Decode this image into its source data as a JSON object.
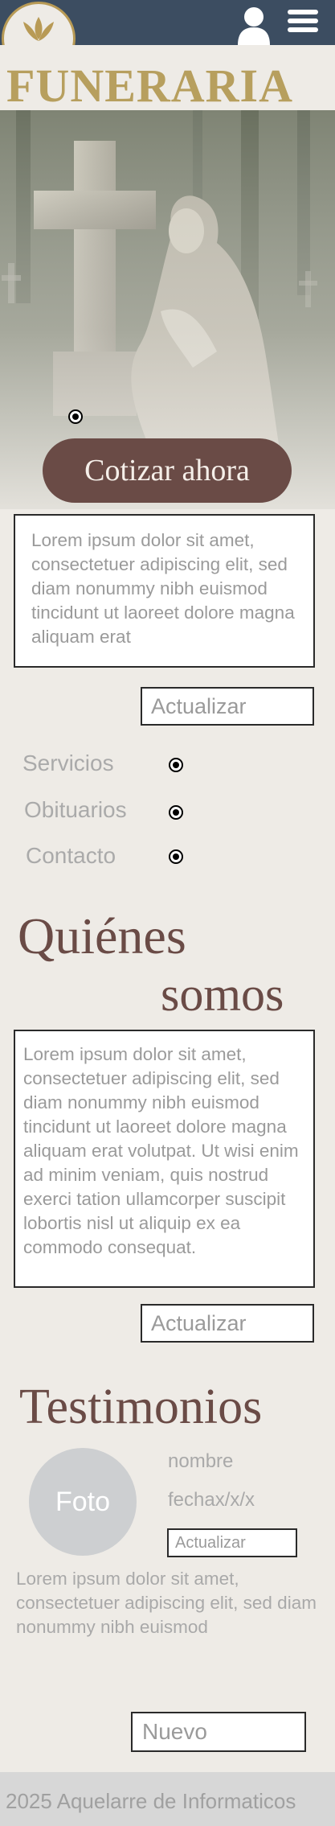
{
  "header": {
    "logo_icon": "lotus-logo-icon",
    "user_icon": "user-icon",
    "menu_icon": "hamburger-menu-icon",
    "brand": "FUNERARIA"
  },
  "hero": {
    "image": "cemetery-cross-and-mourning-statue",
    "cta_label": "Cotizar ahora"
  },
  "intro": {
    "text": "Lorem ipsum dolor sit amet, consectetuer adipiscing elit, sed diam nonummy nibh euismod tincidunt ut laoreet dolore magna aliquam erat",
    "update_label": "Actualizar"
  },
  "nav": {
    "items": [
      {
        "label": "Servicios"
      },
      {
        "label": "Obituarios"
      },
      {
        "label": "Contacto"
      }
    ]
  },
  "about": {
    "title_line1": "Quiénes",
    "title_line2": "somos",
    "text": "Lorem ipsum dolor sit amet, consectetuer adipiscing elit, sed diam nonummy nibh euismod tincidunt ut laoreet dolore magna aliquam erat volutpat. Ut wisi enim ad minim veniam, quis nostrud exerci tation ullamcorper suscipit lobortis nisl ut aliquip ex ea commodo consequat.",
    "update_label": "Actualizar"
  },
  "testimonials": {
    "title": "Testimonios",
    "photo_label": "Foto",
    "name": "nombre",
    "date": "fechax/x/x",
    "update_label": "Actualizar",
    "text": "Lorem ipsum dolor sit amet, consectetuer adipiscing elit, sed diam nonummy nibh euismod",
    "new_label": "Nuevo"
  },
  "footer": {
    "text": "2025 Aquelarre de Informaticos"
  },
  "colors": {
    "topbar": "#3c4d61",
    "brand": "#b79f5e",
    "accent": "#6a4b46",
    "background": "#eeebe6",
    "footer": "#d7d7d7"
  }
}
